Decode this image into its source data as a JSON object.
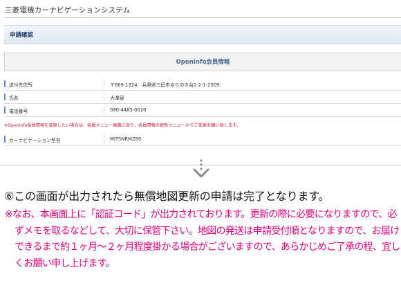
{
  "app": {
    "title": "三菱電機カーナビゲーションシステム"
  },
  "page": {
    "header": "申請確認"
  },
  "info": {
    "heading": "OpenInfo会員情報",
    "rows": [
      {
        "label": "送付先住所",
        "value": "〒669-1324　兵庫県三田市ゆりのき台1-2-1-2509"
      },
      {
        "label": "氏名",
        "value": "大澤競"
      },
      {
        "label": "電話番号",
        "value": "080-4483-0020"
      }
    ],
    "warning": "※OpenInfo会員情報を変更したい場合は、会員メニュー画面に戻り、会員情報の更新メニューからご変更お願い致します。",
    "model_row": {
      "label": "カーナビゲーション型名",
      "value": "MITSNRMZ80"
    }
  },
  "instruction": {
    "main": "⑥この画面が出力されたら無償地図更新の申請は完了となります。",
    "note": "※なお、本画面上に「認証コード」が出力されております。更新の際に必要になりますので、必ずメモを取るなどして、大切に保管下さい。地図の発送は申請受付順となりますので、お届けできるまで約１ヶ月～２ヶ月程度掛かる場合がございますので、あらかじめご了承の程、宜しくお願い申し上げます。"
  },
  "colors": {
    "note_text": "#e4007f",
    "warning_text": "#d81a3a",
    "arrow": "#8a8a8a"
  }
}
